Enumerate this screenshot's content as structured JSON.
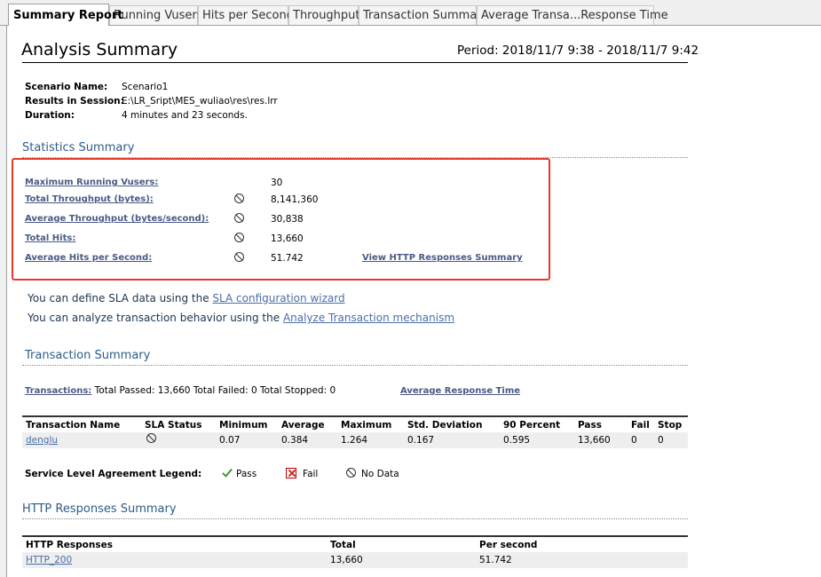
{
  "tabs": [
    "Summary Report",
    "Running Vusers",
    "Hits per Second",
    "Throughput",
    "Transaction Summary",
    "Average Transa...Response Time"
  ],
  "header": {
    "title": "Analysis Summary",
    "period": "Period: 2018/11/7 9:38 - 2018/11/7 9:42"
  },
  "scenario": {
    "name_label": "Scenario Name:",
    "name_value": "Scenario1",
    "results_label": "Results in Session:",
    "results_value": "E:\\LR_Sript\\MES_wuliao\\res\\res.lrr",
    "duration_label": "Duration:",
    "duration_value": "4 minutes and 23 seconds."
  },
  "statistics": {
    "heading": "Statistics Summary",
    "rows": [
      {
        "label": "Maximum Running Vusers:",
        "value": "30",
        "sla": false
      },
      {
        "label": "Total Throughput (bytes):",
        "value": "8,141,360",
        "sla": true
      },
      {
        "label": "Average Throughput (bytes/second):",
        "value": "30,838",
        "sla": true
      },
      {
        "label": "Total Hits:",
        "value": "13,660",
        "sla": true
      },
      {
        "label": "Average Hits per Second:",
        "value": "51.742",
        "sla": true
      }
    ],
    "http_link": "View HTTP Responses Summary",
    "highlight_color": "#e8382b"
  },
  "sla_messages": {
    "line1_prefix": "You can define SLA data using the ",
    "line1_link": "SLA configuration wizard",
    "line2_prefix": "You can analyze transaction behavior using the ",
    "line2_link": "Analyze Transaction mechanism"
  },
  "transaction_summary": {
    "heading": "Transaction Summary",
    "transactions_link": "Transactions:",
    "totals": "Total Passed: 13,660 Total Failed: 0 Total Stopped: 0",
    "avg_link": "Average Response Time",
    "columns": [
      "Transaction Name",
      "SLA Status",
      "Minimum",
      "Average",
      "Maximum",
      "Std. Deviation",
      "90 Percent",
      "Pass",
      "Fail",
      "Stop"
    ],
    "rows": [
      {
        "name": "denglu",
        "minimum": "0.07",
        "average": "0.384",
        "maximum": "1.264",
        "std": "0.167",
        "p90": "0.595",
        "pass": "13,660",
        "fail": "0",
        "stop": "0"
      }
    ]
  },
  "legend": {
    "label": "Service Level Agreement Legend:",
    "pass": "Pass",
    "fail": "Fail",
    "nodata": "No Data",
    "icons": [
      "check-icon",
      "fail-icon",
      "no-data-icon"
    ]
  },
  "http_summary": {
    "heading": "HTTP Responses Summary",
    "columns": [
      "HTTP Responses",
      "Total",
      "Per second"
    ],
    "rows": [
      {
        "code": "HTTP_200",
        "total": "13,660",
        "per_second": "51.742"
      }
    ]
  }
}
